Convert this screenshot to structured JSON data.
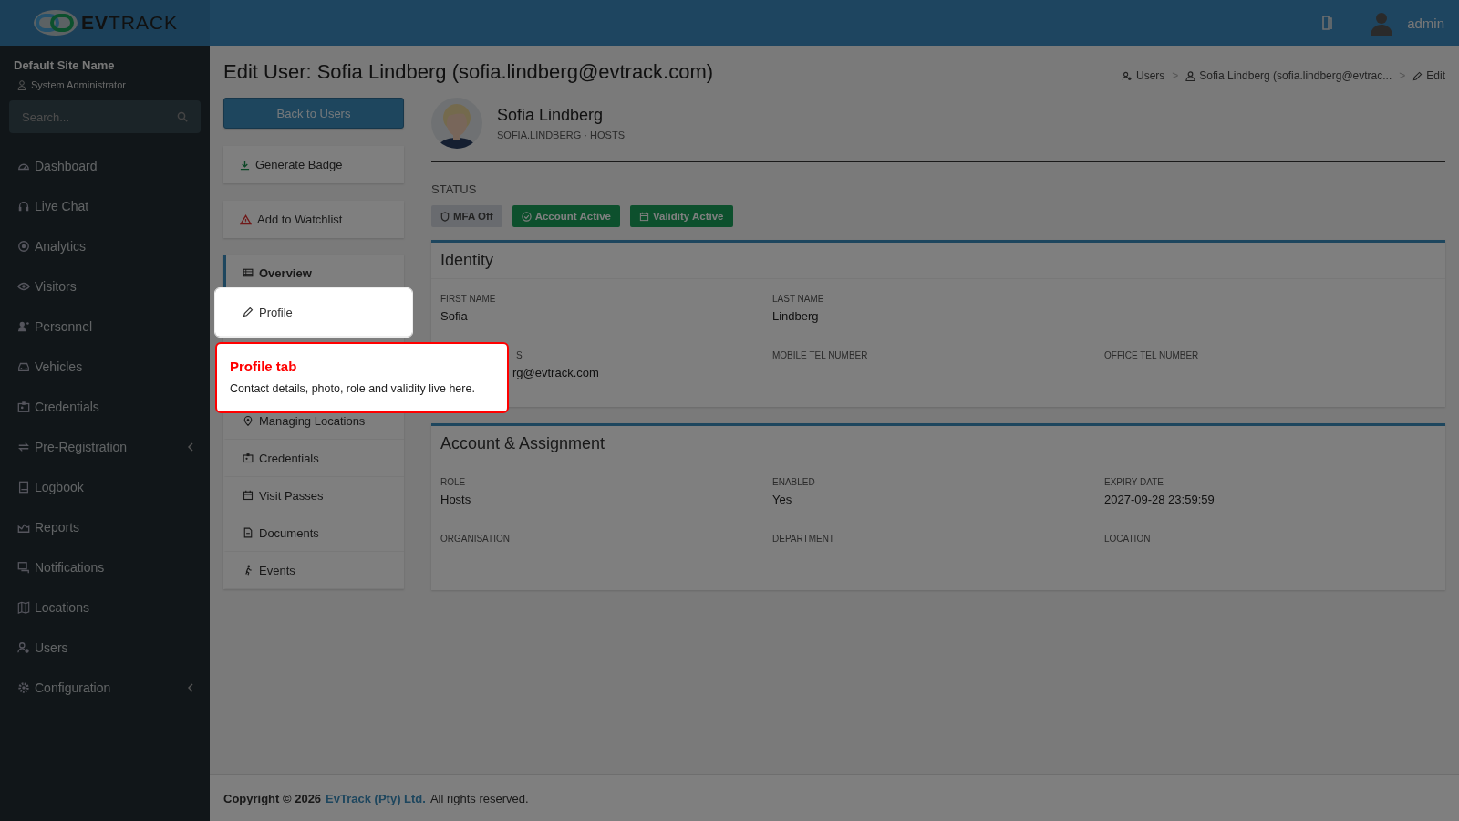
{
  "brand": {
    "logo": "**EV**TRACK"
  },
  "topbar": {
    "user": "admin"
  },
  "sidebar": {
    "site": "Default Site Name",
    "role": "System Administrator",
    "search": {
      "placeholder": "Search..."
    },
    "items": [
      {
        "label": "Dashboard",
        "has_submenu": false
      },
      {
        "label": "Live Chat",
        "has_submenu": false
      },
      {
        "label": "Analytics",
        "has_submenu": false
      },
      {
        "label": "Visitors",
        "has_submenu": false
      },
      {
        "label": "Personnel",
        "has_submenu": false
      },
      {
        "label": "Vehicles",
        "has_submenu": false
      },
      {
        "label": "Credentials",
        "has_submenu": false
      },
      {
        "label": "Pre-Registration",
        "has_submenu": true
      },
      {
        "label": "Logbook",
        "has_submenu": false
      },
      {
        "label": "Reports",
        "has_submenu": false
      },
      {
        "label": "Notifications",
        "has_submenu": false
      },
      {
        "label": "Locations",
        "has_submenu": false
      },
      {
        "label": "Users",
        "has_submenu": false
      },
      {
        "label": "Configuration",
        "has_submenu": true
      }
    ]
  },
  "page": {
    "title": "Edit User: Sofia Lindberg (sofia.lindberg@evtrack.com)",
    "breadcrumb": {
      "separator": ">",
      "items": [
        {
          "label": "Users",
          "kind": "users"
        },
        {
          "label": "Sofia Lindberg (sofia.lindberg@evtrac...",
          "kind": "user"
        },
        {
          "label": "Edit",
          "kind": "edit"
        }
      ]
    }
  },
  "actions": [
    {
      "label": "Back to Users",
      "kind": "primary"
    },
    {
      "label": "Generate Badge",
      "kind": "download"
    },
    {
      "label": "Add to Watchlist",
      "kind": "warning"
    }
  ],
  "tabs": [
    {
      "label": "Overview",
      "selected": true,
      "spotlight": false
    },
    {
      "label": "Profile",
      "selected": false,
      "spotlight": true
    },
    {
      "label": "Managing Locations",
      "selected": false,
      "spotlight": false
    },
    {
      "label": "Credentials",
      "selected": false,
      "spotlight": false
    },
    {
      "label": "Visit Passes",
      "selected": false,
      "spotlight": false
    },
    {
      "label": "Documents",
      "selected": false,
      "spotlight": false
    },
    {
      "label": "Events",
      "selected": false,
      "spotlight": false
    }
  ],
  "tour": {
    "title": "Profile tab",
    "text": "Contact details, photo, role and validity live here."
  },
  "profile": {
    "name": "Sofia Lindberg",
    "subtitle": "SOFIA.LINDBERG · HOSTS"
  },
  "status": {
    "label": "STATUS",
    "badges": [
      {
        "label": "MFA Off",
        "kind": "off"
      },
      {
        "label": "Account Active",
        "kind": "active"
      },
      {
        "label": "Validity Active",
        "kind": "validity"
      }
    ]
  },
  "cards": [
    {
      "title": "Identity",
      "rows": [
        [
          {
            "label": "FIRST NAME",
            "value": "Sofia"
          },
          {
            "label": "LAST NAME",
            "value": "Lindberg"
          }
        ],
        [
          {
            "label": "S",
            "value": "rg@evtrack.com",
            "covered": true
          },
          {
            "label": "MOBILE TEL NUMBER"
          },
          {
            "label": "OFFICE TEL NUMBER"
          }
        ]
      ]
    },
    {
      "title": "Account & Assignment",
      "rows": [
        [
          {
            "label": "ROLE",
            "value": "Hosts"
          },
          {
            "label": "ENABLED",
            "value": "Yes"
          },
          {
            "label": "EXPIRY DATE",
            "value": "2027-09-28 23:59:59"
          }
        ],
        [
          {
            "label": "ORGANISATION"
          },
          {
            "label": "DEPARTMENT"
          },
          {
            "label": "LOCATION"
          }
        ]
      ]
    }
  ],
  "footer": {
    "prefix": "Copyright © 2026",
    "link": "EvTrack (Pty) Ltd.",
    "suffix": "All rights reserved."
  }
}
